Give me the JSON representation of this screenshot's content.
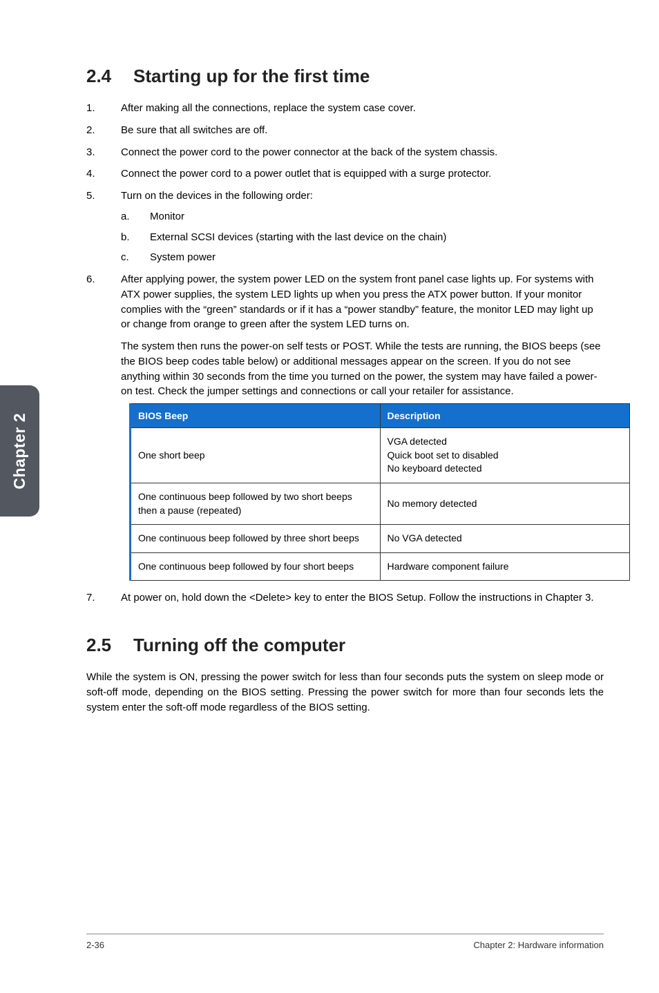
{
  "sidebar": {
    "label": "Chapter 2"
  },
  "section24": {
    "num": "2.4",
    "title": "Starting up for the first time",
    "items": [
      "After making all the connections, replace the system case cover.",
      "Be sure that all switches are off.",
      "Connect the power cord to the power connector at the back of the system chassis.",
      "Connect the power cord to a power outlet that is equipped with a surge protector.",
      "Turn on the devices in the following order:"
    ],
    "subitems": [
      "Monitor",
      "External SCSI devices (starting with the last device on the chain)",
      "System power"
    ],
    "item6_p1": "After applying power, the system power LED on the system front panel case lights up. For systems with ATX power supplies, the system LED lights up when you press the ATX power button. If your monitor complies with the “green” standards or if it has a “power standby” feature, the monitor LED may light up or change from orange to green after the system LED turns on.",
    "item6_p2": "The system then runs the power-on self tests or POST. While the tests are running, the BIOS beeps (see the BIOS beep codes table below) or additional messages appear on the screen. If you do not see anything within 30 seconds from the time you turned on the power, the system may have failed a power-on test. Check the jumper settings and connections or call your retailer for assistance.",
    "item7": "At power on, hold down the <Delete> key to enter the BIOS Setup. Follow the instructions in Chapter 3."
  },
  "table": {
    "headers": [
      "BIOS Beep",
      "Description"
    ],
    "rows": [
      [
        "One short beep",
        "VGA detected\nQuick boot set to disabled\nNo keyboard detected"
      ],
      [
        "One continuous beep followed by two short beeps then a pause (repeated)",
        "No memory detected"
      ],
      [
        "One continuous beep followed by three short beeps",
        "No VGA detected"
      ],
      [
        "One continuous beep followed by four short beeps",
        "Hardware component failure"
      ]
    ]
  },
  "section25": {
    "num": "2.5",
    "title": "Turning off the computer",
    "body": "While the system is ON, pressing the power switch for less than four seconds puts the system on sleep mode or soft-off mode, depending on the BIOS setting. Pressing the power switch for more than four seconds lets the system enter the soft-off mode regardless of the BIOS setting."
  },
  "footer": {
    "page": "2-36",
    "chapter": "Chapter 2: Hardware information"
  }
}
